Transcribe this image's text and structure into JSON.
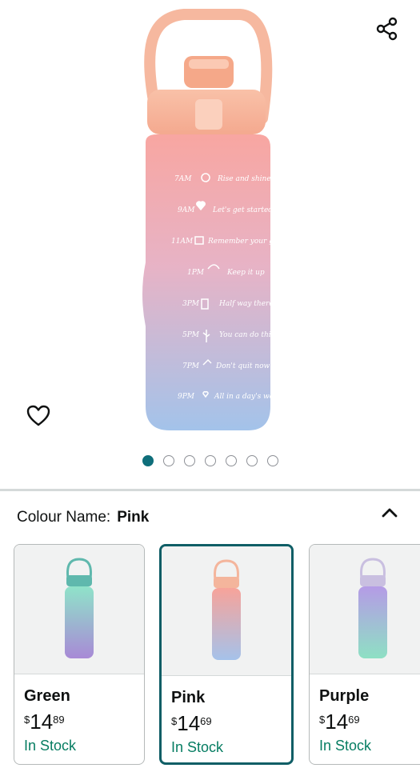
{
  "product": {
    "image_dots": 7,
    "active_dot": 0,
    "bottle_markings": [
      {
        "time": "7AM",
        "text": "Rise and shine"
      },
      {
        "time": "9AM",
        "text": "Let's get started"
      },
      {
        "time": "11AM",
        "text": "Remember your goal"
      },
      {
        "time": "1PM",
        "text": "Keep it up"
      },
      {
        "time": "3PM",
        "text": "Half way there"
      },
      {
        "time": "5PM",
        "text": "You can do this"
      },
      {
        "time": "7PM",
        "text": "Don't quit now"
      },
      {
        "time": "9PM",
        "text": "All in a day's work"
      }
    ]
  },
  "colour": {
    "label": "Colour Name:",
    "selected": "Pink"
  },
  "swatches": [
    {
      "name": "Green",
      "currency": "$",
      "price_whole": "14",
      "price_fraction": "89",
      "stock": "In Stock",
      "top_color": "#8fe3c9",
      "bottom_color": "#a88ad6",
      "cap_color": "#5fb8ad"
    },
    {
      "name": "Pink",
      "currency": "$",
      "price_whole": "14",
      "price_fraction": "69",
      "stock": "In Stock",
      "top_color": "#f7a39a",
      "bottom_color": "#a5c2ea",
      "cap_color": "#f4b59c"
    },
    {
      "name": "Purple",
      "currency": "$",
      "price_whole": "14",
      "price_fraction": "69",
      "stock": "In Stock",
      "top_color": "#b59be6",
      "bottom_color": "#8ee0c4",
      "cap_color": "#c9bfe0"
    }
  ],
  "icons": {
    "share": "share-icon",
    "wishlist": "heart-outline-icon",
    "collapse": "chevron-up-icon"
  },
  "colors": {
    "selected_border": "#0f5e66",
    "in_stock": "#067d62",
    "dot_active": "#0f6e7a"
  }
}
